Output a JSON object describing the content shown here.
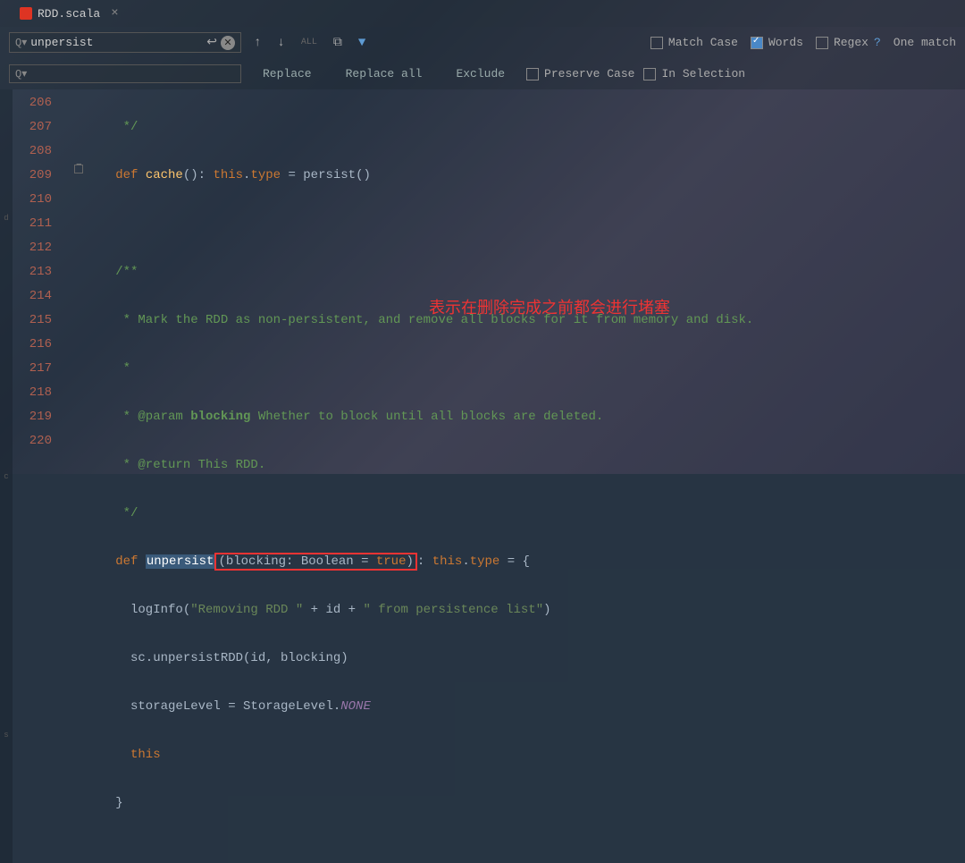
{
  "tab": {
    "filename": "RDD.scala"
  },
  "find": {
    "query": "unpersist",
    "matchCase": "Match Case",
    "words": "Words",
    "regex": "Regex",
    "matchCount": "One match"
  },
  "replace": {
    "replaceBtn": "Replace",
    "replaceAllBtn": "Replace all",
    "excludeBtn": "Exclude",
    "preserveCase": "Preserve Case",
    "inSelection": "In Selection"
  },
  "lines": {
    "l206": "206",
    "l207": "207",
    "l208": "208",
    "l209": "209",
    "l210": "210",
    "l211": "211",
    "l212": "212",
    "l213": "213",
    "l214": "214",
    "l215": "215",
    "l216": "216",
    "l217": "217",
    "l218": "218",
    "l219": "219",
    "l220": "220"
  },
  "code": {
    "c206": "    */",
    "c207_def": "   def ",
    "c207_cache": "cache",
    "c207_paren": "(): ",
    "c207_this": "this",
    "c207_dot": ".",
    "c207_type": "type",
    "c207_eq": " = persist()",
    "c209": "   /**",
    "c210": "    * Mark the RDD as non-persistent, and remove all blocks for it from memory and disk.",
    "c211": "    *",
    "c212_a": "    * @param ",
    "c212_b": "blocking",
    "c212_c": " Whether to block until all blocks are deleted.",
    "c213": "    * @return This RDD.",
    "c214": "    */",
    "c215_def": "   def ",
    "c215_unpersist": "unpersist",
    "c215_open": "(",
    "c215_param": "blocking: Boolean = ",
    "c215_true": "true",
    "c215_close": ")",
    "c215_colon": ": ",
    "c215_this": "this",
    "c215_dot": ".",
    "c215_type": "type",
    "c215_eq": " = {",
    "c216_a": "     logInfo(",
    "c216_s1": "\"Removing RDD \"",
    "c216_b": " + id + ",
    "c216_s2": "\" from persistence list\"",
    "c216_c": ")",
    "c217": "     sc.unpersistRDD(id, blocking)",
    "c218_a": "     storageLevel = StorageLevel.",
    "c218_b": "NONE",
    "c219_this": "     this",
    "c220": "   }"
  },
  "annotation": "表示在删除完成之前都会进行堵塞"
}
